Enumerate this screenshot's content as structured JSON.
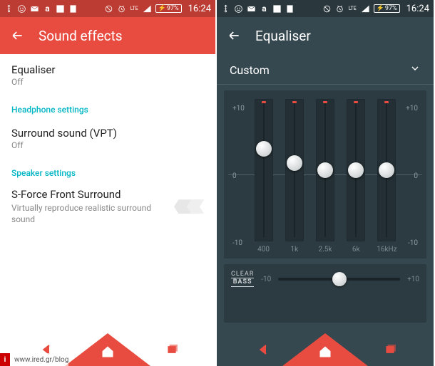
{
  "status": {
    "time": "16:24",
    "battery": "97%"
  },
  "left": {
    "title": "Sound effects",
    "equaliser": {
      "label": "Equaliser",
      "status": "Off"
    },
    "headphone_hdr": "Headphone settings",
    "vpt": {
      "label": "Surround sound (VPT)",
      "status": "Off"
    },
    "speaker_hdr": "Speaker settings",
    "sforce": {
      "label": "S-Force Front Surround",
      "desc": "Virtually reproduce realistic surround sound"
    }
  },
  "right": {
    "title": "Equaliser",
    "preset": "Custom",
    "scale": {
      "top": "+10",
      "mid": "0",
      "bot": "-10"
    },
    "bands": [
      {
        "freq": "400",
        "value": 3
      },
      {
        "freq": "1k",
        "value": 1
      },
      {
        "freq": "2.5k",
        "value": 0
      },
      {
        "freq": "6k",
        "value": 0
      },
      {
        "freq": "16kHz",
        "value": 0
      }
    ],
    "bass": {
      "label_top": "CLEAR",
      "label_bot": "BASS",
      "min": "-10",
      "max": "+10",
      "value": 0
    }
  },
  "footer": "www.ired.gr/blog"
}
